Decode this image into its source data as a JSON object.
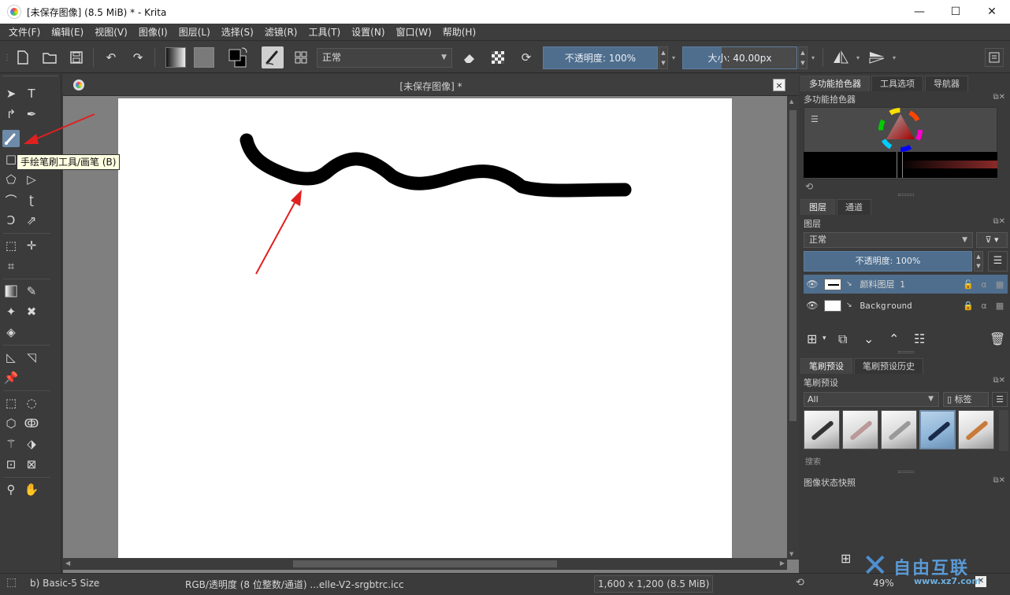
{
  "window": {
    "title": "[未保存图像]  (8.5 MiB)  * - Krita",
    "minimize": "—",
    "maximize": "☐",
    "close": "✕"
  },
  "menu": [
    "文件(F)",
    "编辑(E)",
    "视图(V)",
    "图像(I)",
    "图层(L)",
    "选择(S)",
    "滤镜(R)",
    "工具(T)",
    "设置(N)",
    "窗口(W)",
    "帮助(H)"
  ],
  "toolbar": {
    "blend_mode": "正常",
    "opacity": "不透明度:  100%",
    "size": "大小:  40.00px"
  },
  "tooltip": "手绘笔刷工具/画笔 (B)",
  "document": {
    "tab_title": "[未保存图像]  *",
    "close": "×"
  },
  "dockers": {
    "top_tabs": [
      "多功能拾色器",
      "工具选项",
      "导航器"
    ],
    "color_selector_title": "多功能拾色器",
    "layers_tabs": [
      "图层",
      "通道"
    ],
    "layers_title": "图层",
    "layer_blend": "正常",
    "layer_opacity": "不透明度:   100%",
    "layers": [
      {
        "name": "颜料图层  1",
        "selected": true
      },
      {
        "name": "Background",
        "selected": false
      }
    ],
    "presets_tabs": [
      "笔刷预设",
      "笔刷预设历史"
    ],
    "presets_title": "笔刷预设",
    "preset_filter": "All",
    "preset_tag": "标签",
    "preset_search": "搜索",
    "snapshot_title": "图像状态快照"
  },
  "status": {
    "brush": "b) Basic-5 Size",
    "colorspace": "RGB/透明度 (8 位整数/通道)  ...elle-V2-srgbtrc.icc",
    "dimensions": "1,600 x 1,200 (8.5 MiB)",
    "zoom": "49%"
  },
  "watermark": {
    "text": "自由互联",
    "url": "www.xz7.com"
  },
  "colors": {
    "accent": "#4f6e8d",
    "annotation_arrow": "#e02020",
    "stroke": "#000000"
  }
}
